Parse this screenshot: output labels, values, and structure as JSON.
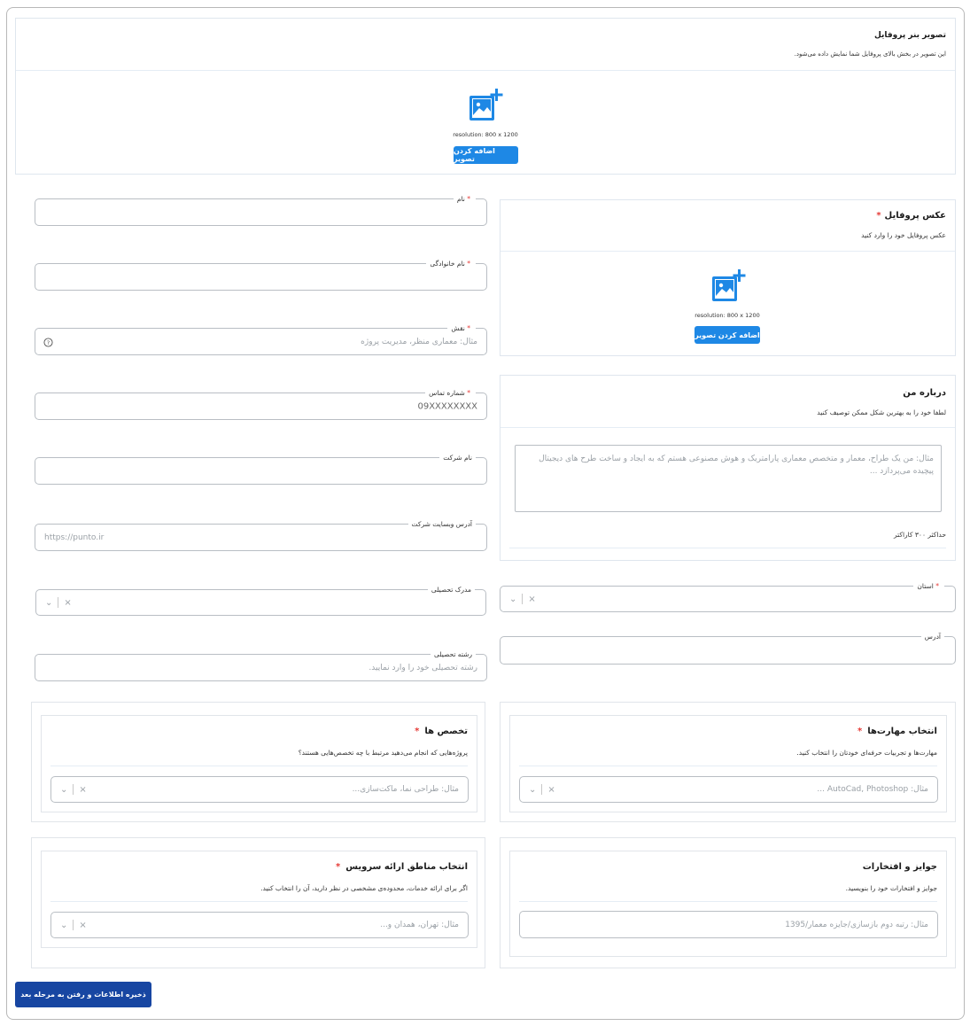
{
  "banner": {
    "title": "تصویر بنر پروفایل",
    "description": "این تصویر در بخش بالای پروفایل شما نمایش داده می‌شود.",
    "resolution": "resolution: 800 x 1200",
    "add_button": "اضافه کردن تصویر",
    "icon": "add-image-icon"
  },
  "profile_photo": {
    "title": "عکس پروفایل",
    "required": "*",
    "description": "عکس پروفایل خود را وارد کنید",
    "resolution": "resolution: 800 x 1200",
    "add_button": "اضافه کردن تصویر",
    "icon": "add-image-icon"
  },
  "fields": {
    "first_name": {
      "label": "نام",
      "required": "*",
      "value": ""
    },
    "last_name": {
      "label": "نام خانوادگی",
      "required": "*",
      "value": ""
    },
    "role": {
      "label": "نقش",
      "required": "*",
      "placeholder": "مثال: معماری منظر، مدیریت پروژه",
      "icon": "help-circle-icon"
    },
    "phone": {
      "label": "شماره تماس",
      "required": "*",
      "value": "09XXXXXXXX"
    },
    "company": {
      "label": "نام شرکت",
      "value": ""
    },
    "website": {
      "label": "آدرس وبسایت شرکت",
      "placeholder": "https://punto.ir"
    },
    "degree": {
      "label": "مدرک تحصیلی",
      "clear": "×",
      "chevron": "⌄"
    },
    "major": {
      "label": "رشته تحصیلی",
      "placeholder": "رشته تحصیلی خود را وارد نمایید."
    },
    "province": {
      "label": "استان",
      "required": "*",
      "clear": "×",
      "chevron": "⌄"
    },
    "address": {
      "label": "آدرس",
      "value": ""
    }
  },
  "about": {
    "title": "درباره من",
    "description": "لطفا خود را به بهترین شکل ممکن توصیف کنید",
    "placeholder": "مثال: من یک طراح، معمار و متخصص معماری پارامتریک و هوش مصنوعی هستم که به ایجاد و ساخت طرح های دیجیتال پیچیده می‌پردازد ...",
    "limit": "حداکثر ۳۰۰ کاراکتر"
  },
  "specialties": {
    "title": "تخصص ها",
    "required": "*",
    "description": "پروژه‌هایی که انجام می‌دهید مرتبط با چه تخصص‌هایی هستند؟",
    "placeholder": "مثال: طراحی نما، ماکت‌سازی...",
    "clear": "×",
    "chevron": "⌄"
  },
  "skills": {
    "title": "انتخاب مهارت‌ها",
    "required": "*",
    "description": "مهارت‌ها و تجربیات حرفه‌ای خودتان را انتخاب کنید.",
    "placeholder": "مثال: AutoCad, Photoshop ...",
    "clear": "×",
    "chevron": "⌄"
  },
  "service_areas": {
    "title": "انتخاب مناطق ارائه سرویس",
    "required": "*",
    "description": "اگر برای ارائه خدمات، محدوده‌ی مشخصی در نظر دارید، آن را انتخاب کنید.",
    "placeholder": "مثال: تهران، همدان و...",
    "clear": "×",
    "chevron": "⌄"
  },
  "awards": {
    "title": "جوایز و افتخارات",
    "description": "جوایز و افتخارات خود را بنویسید.",
    "placeholder": "مثال: رتبه دوم بازسازی/جایزه معمار/1395"
  },
  "save_button": "ذخیره اطلاعات و رفتن به مرحله بعد",
  "colors": {
    "accent": "#1e88e5",
    "save": "#1746a2",
    "required": "#e53935"
  }
}
